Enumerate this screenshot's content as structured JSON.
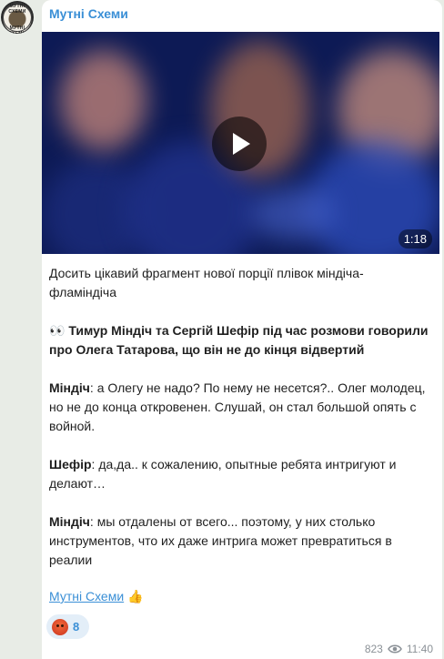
{
  "channel": {
    "name": "Мутні Схеми",
    "avatar_text_top": "МУТНІ СХЕМИ",
    "avatar_text_bottom": "МУТНІ СХЕМИ"
  },
  "video": {
    "duration": "1:18"
  },
  "message": {
    "intro_line1": "Досить цікавий фрагмент нової порції плівок міндіча-",
    "intro_line2": "фламіндіча",
    "highlight_emoji": "👀",
    "highlight_line1": "Тимур Міндіч та Сергій Шефір під час розмови говорили",
    "highlight_line2": "про Олега Татарова, що він не до кінця відвертий",
    "q1_speaker": "Міндіч",
    "q1_line1": ": а Олегу не надо? По нему не несется?.. Олег молодец,",
    "q1_line2": "но не до конца откровенен. Слушай, он стал большой опять с",
    "q1_line3": "войной.",
    "q2_speaker": "Шефір",
    "q2_line1": ": да,да.. к сожалению, опытные ребята интригуют и",
    "q2_line2": "делают…",
    "q3_speaker": "Міндіч",
    "q3_line1": ": мы отдалены от всего... поэтому, у них столько",
    "q3_line2": "инструментов, что их даже интрига может превратиться в",
    "q3_line3": "реалии"
  },
  "signature": {
    "link": "Мутні Схеми",
    "emoji": "👍"
  },
  "reaction": {
    "icon": "angry-face-icon",
    "count": "8"
  },
  "footer": {
    "views": "823",
    "time": "11:40"
  },
  "colors": {
    "accent": "#3a8fd6",
    "background": "#e8ece6"
  }
}
